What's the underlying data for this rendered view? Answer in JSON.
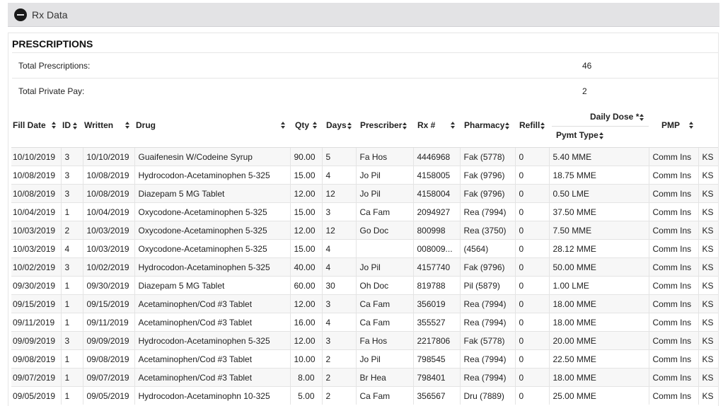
{
  "panel": {
    "title": "Rx Data",
    "collapse_icon": "minus-circle-icon"
  },
  "section": {
    "title": "PRESCRIPTIONS",
    "summary": [
      {
        "label": "Total Prescriptions:",
        "value": "46"
      },
      {
        "label": "Total Private Pay:",
        "value": "2"
      }
    ]
  },
  "table": {
    "headers": {
      "fill_date": "Fill Date",
      "id": "ID",
      "written": "Written",
      "drug": "Drug",
      "qty": "Qty",
      "days": "Days",
      "prescriber": "Prescriber",
      "rx": "Rx #",
      "pharmacy": "Pharmacy",
      "refill": "Refill",
      "daily_dose": "Daily Dose *",
      "pymt_type": "Pymt Type",
      "pmp": "PMP"
    },
    "rows": [
      {
        "fill_date": "10/10/2019",
        "id": "3",
        "written": "10/10/2019",
        "drug": "Guaifenesin W/Codeine Syrup",
        "qty": "90.00",
        "days": "5",
        "prescriber": "Fa Hos",
        "rx": "4446968",
        "pharmacy": "Fak (5778)",
        "refill": "0",
        "dose": "5.40 MME",
        "pymt": "Comm Ins",
        "pmp": "KS"
      },
      {
        "fill_date": "10/08/2019",
        "id": "3",
        "written": "10/08/2019",
        "drug": "Hydrocodon-Acetaminophen 5-325",
        "qty": "15.00",
        "days": "4",
        "prescriber": "Jo Pil",
        "rx": "4158005",
        "pharmacy": "Fak (9796)",
        "refill": "0",
        "dose": "18.75 MME",
        "pymt": "Comm Ins",
        "pmp": "KS"
      },
      {
        "fill_date": "10/08/2019",
        "id": "3",
        "written": "10/08/2019",
        "drug": "Diazepam 5 MG Tablet",
        "qty": "12.00",
        "days": "12",
        "prescriber": "Jo Pil",
        "rx": "4158004",
        "pharmacy": "Fak (9796)",
        "refill": "0",
        "dose": "0.50 LME",
        "pymt": "Comm Ins",
        "pmp": "KS"
      },
      {
        "fill_date": "10/04/2019",
        "id": "1",
        "written": "10/04/2019",
        "drug": "Oxycodone-Acetaminophen 5-325",
        "qty": "15.00",
        "days": "3",
        "prescriber": "Ca Fam",
        "rx": "2094927",
        "pharmacy": "Rea (7994)",
        "refill": "0",
        "dose": "37.50 MME",
        "pymt": "Comm Ins",
        "pmp": "KS"
      },
      {
        "fill_date": "10/03/2019",
        "id": "2",
        "written": "10/03/2019",
        "drug": "Oxycodone-Acetaminophen 5-325",
        "qty": "12.00",
        "days": "12",
        "prescriber": "Go Doc",
        "rx": "800998",
        "pharmacy": "Rea (3750)",
        "refill": "0",
        "dose": "7.50 MME",
        "pymt": "Comm Ins",
        "pmp": "KS"
      },
      {
        "fill_date": "10/03/2019",
        "id": "4",
        "written": "10/03/2019",
        "drug": "Oxycodone-Acetaminophen 5-325",
        "qty": "15.00",
        "days": "4",
        "prescriber": "",
        "rx": "008009...",
        "pharmacy": "(4564)",
        "refill": "0",
        "dose": "28.12 MME",
        "pymt": "Comm Ins",
        "pmp": "KS"
      },
      {
        "fill_date": "10/02/2019",
        "id": "3",
        "written": "10/02/2019",
        "drug": "Hydrocodon-Acetaminophen 5-325",
        "qty": "40.00",
        "days": "4",
        "prescriber": "Jo Pil",
        "rx": "4157740",
        "pharmacy": "Fak (9796)",
        "refill": "0",
        "dose": "50.00 MME",
        "pymt": "Comm Ins",
        "pmp": "KS"
      },
      {
        "fill_date": "09/30/2019",
        "id": "1",
        "written": "09/30/2019",
        "drug": "Diazepam 5 MG Tablet",
        "qty": "60.00",
        "days": "30",
        "prescriber": "Oh Doc",
        "rx": "819788",
        "pharmacy": "Pil (5879)",
        "refill": "0",
        "dose": "1.00 LME",
        "pymt": "Comm Ins",
        "pmp": "KS"
      },
      {
        "fill_date": "09/15/2019",
        "id": "1",
        "written": "09/15/2019",
        "drug": "Acetaminophen/Cod #3 Tablet",
        "qty": "12.00",
        "days": "3",
        "prescriber": "Ca Fam",
        "rx": "356019",
        "pharmacy": "Rea (7994)",
        "refill": "0",
        "dose": "18.00 MME",
        "pymt": "Comm Ins",
        "pmp": "KS"
      },
      {
        "fill_date": "09/11/2019",
        "id": "1",
        "written": "09/11/2019",
        "drug": "Acetaminophen/Cod #3 Tablet",
        "qty": "16.00",
        "days": "4",
        "prescriber": "Ca Fam",
        "rx": "355527",
        "pharmacy": "Rea (7994)",
        "refill": "0",
        "dose": "18.00 MME",
        "pymt": "Comm Ins",
        "pmp": "KS"
      },
      {
        "fill_date": "09/09/2019",
        "id": "3",
        "written": "09/09/2019",
        "drug": "Hydrocodon-Acetaminophen 5-325",
        "qty": "12.00",
        "days": "3",
        "prescriber": "Fa Hos",
        "rx": "2217806",
        "pharmacy": "Fak (5778)",
        "refill": "0",
        "dose": "20.00 MME",
        "pymt": "Comm Ins",
        "pmp": "KS"
      },
      {
        "fill_date": "09/08/2019",
        "id": "1",
        "written": "09/08/2019",
        "drug": "Acetaminophen/Cod #3 Tablet",
        "qty": "10.00",
        "days": "2",
        "prescriber": "Jo Pil",
        "rx": "798545",
        "pharmacy": "Rea (7994)",
        "refill": "0",
        "dose": "22.50 MME",
        "pymt": "Comm Ins",
        "pmp": "KS"
      },
      {
        "fill_date": "09/07/2019",
        "id": "1",
        "written": "09/07/2019",
        "drug": "Acetaminophen/Cod #3 Tablet",
        "qty": "8.00",
        "days": "2",
        "prescriber": "Br Hea",
        "rx": "798401",
        "pharmacy": "Rea (7994)",
        "refill": "0",
        "dose": "18.00 MME",
        "pymt": "Comm Ins",
        "pmp": "KS"
      },
      {
        "fill_date": "09/05/2019",
        "id": "1",
        "written": "09/05/2019",
        "drug": "Hydrocodon-Acetaminophn 10-325",
        "qty": "5.00",
        "days": "2",
        "prescriber": "Ca Fam",
        "rx": "356567",
        "pharmacy": "Dru (7889)",
        "refill": "0",
        "dose": "25.00 MME",
        "pymt": "Comm Ins",
        "pmp": "KS"
      }
    ]
  }
}
